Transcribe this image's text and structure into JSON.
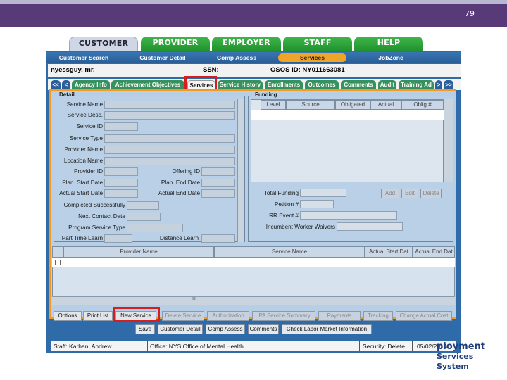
{
  "slide_number": "79",
  "main_tabs": [
    "CUSTOMER",
    "PROVIDER",
    "EMPLOYER",
    "STAFF",
    "HELP"
  ],
  "sub_nav": [
    "Customer Search",
    "Customer Detail",
    "Comp Assess",
    "Services",
    "JobZone"
  ],
  "customer": {
    "name": "nyessguy, mr.",
    "ssn_label": "SSN:",
    "osos_id": "OSOS ID: NY011663081"
  },
  "panel_tabs": [
    "<<",
    "<",
    "Agency Info",
    "Achievement Objectives",
    "Services",
    "Service History",
    "Enrollments",
    "Outcomes",
    "Comments",
    "Audit",
    "Training Ad",
    ">",
    ">>"
  ],
  "detail": {
    "legend": "Detail",
    "labels": [
      "Service Name",
      "Service Desc.",
      "Service ID",
      "Service Type",
      "Provider Name",
      "Location Name",
      "Provider ID",
      "Plan. Start Date",
      "Actual Start Date",
      "Completed Successfully",
      "Next Contact Date",
      "Program Service Type",
      "Part Time Learn"
    ],
    "right_labels": [
      "Offering ID",
      "Plan. End Date",
      "Actual End Date",
      "Distance Learn"
    ]
  },
  "funding": {
    "legend": "Funding",
    "columns": [
      "Level",
      "Source",
      "Obligated",
      "Actual",
      "Oblig #"
    ],
    "buttons": [
      "Add",
      "Edit",
      "Delete"
    ],
    "labels": [
      "Total Funding",
      "Petition #",
      "RR Event #",
      "Incumbent Worker Waivers"
    ]
  },
  "grid": {
    "columns": [
      "Provider Name",
      "Service Name",
      "Actual Start Dat",
      "Actual End Dat"
    ],
    "scroll_marker": "III"
  },
  "bottom_buttons": [
    "Options",
    "Print List",
    "New Service",
    "Delete Service",
    "Authorization",
    "IPA Service Summary",
    "Payments",
    "Tracking",
    "Change Actual Cost"
  ],
  "action_buttons": [
    "Save",
    "Customer Detail",
    "Comp Assess",
    "Comments",
    "Check Labor Market Information"
  ],
  "status": {
    "staff": "Staff: Karhan, Andrew",
    "office": "Office: NYS Office of Mental Health",
    "security": "Security: Delete",
    "date": "05/02/2014"
  },
  "logo": {
    "line1": "ployment",
    "line2": "Services System"
  },
  "colors": {
    "header_purple": "#583a78",
    "app_blue": "#2f6ba8",
    "accent_orange": "#f39a24",
    "tab_green": "#37915d",
    "highlight_red": "#d51f1f"
  }
}
